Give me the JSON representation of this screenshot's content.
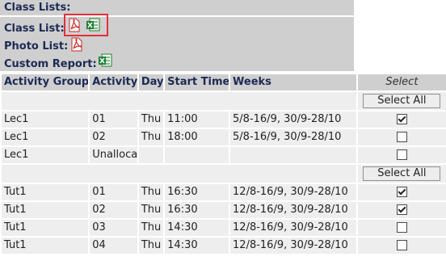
{
  "header": {
    "class_lists": "Class Lists:",
    "class_list": "Class List:",
    "photo_list": "Photo List:",
    "custom_report": "Custom Report:"
  },
  "icons": {
    "pdf": "pdf-icon",
    "excel": "excel-icon",
    "accent": "#e0303b"
  },
  "table": {
    "headers": [
      "Activity Group",
      "Activity",
      "Day",
      "Start Time",
      "Weeks",
      "Select"
    ],
    "select_all_label": "Select All",
    "groups": [
      {
        "rows": [
          {
            "group": "Lec1",
            "activity": "01",
            "day": "Thu",
            "time": "11:00",
            "weeks": "5/8-16/9, 30/9-28/10",
            "checked": true
          },
          {
            "group": "Lec1",
            "activity": "02",
            "day": "Thu",
            "time": "18:00",
            "weeks": "5/8-16/9, 30/9-28/10",
            "checked": false
          },
          {
            "group": "Lec1",
            "activity": "Unallocated",
            "day": "",
            "time": "",
            "weeks": "",
            "checked": false
          }
        ]
      },
      {
        "rows": [
          {
            "group": "Tut1",
            "activity": "01",
            "day": "Thu",
            "time": "16:30",
            "weeks": "12/8-16/9, 30/9-28/10",
            "checked": true
          },
          {
            "group": "Tut1",
            "activity": "02",
            "day": "Thu",
            "time": "16:30",
            "weeks": "12/8-16/9, 30/9-28/10",
            "checked": true
          },
          {
            "group": "Tut1",
            "activity": "03",
            "day": "Thu",
            "time": "14:30",
            "weeks": "12/8-16/9, 30/9-28/10",
            "checked": false
          },
          {
            "group": "Tut1",
            "activity": "04",
            "day": "Thu",
            "time": "14:30",
            "weeks": "12/8-16/9, 30/9-28/10",
            "checked": false
          }
        ]
      }
    ]
  }
}
